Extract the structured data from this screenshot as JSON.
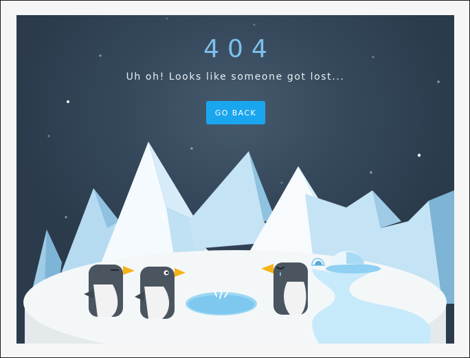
{
  "page": {
    "heading": "404",
    "message": "Uh oh! Looks like someone got lost...",
    "back_button_label": "GO BACK"
  },
  "colors": {
    "background": "#34475a",
    "heading": "#7cc1ee",
    "button": "#1aa6ee",
    "button_text": "#ffffff",
    "message_text": "#e9eef2",
    "ice": "#c9e6f7",
    "water": "#8fd0f3",
    "penguin_body": "#4a5560",
    "penguin_belly": "#f2f2f2",
    "penguin_beak": "#f5b414"
  },
  "icons": [
    "mountain-icon",
    "igloo-icon",
    "penguin-icon",
    "ice-hole-icon",
    "star-icon"
  ]
}
